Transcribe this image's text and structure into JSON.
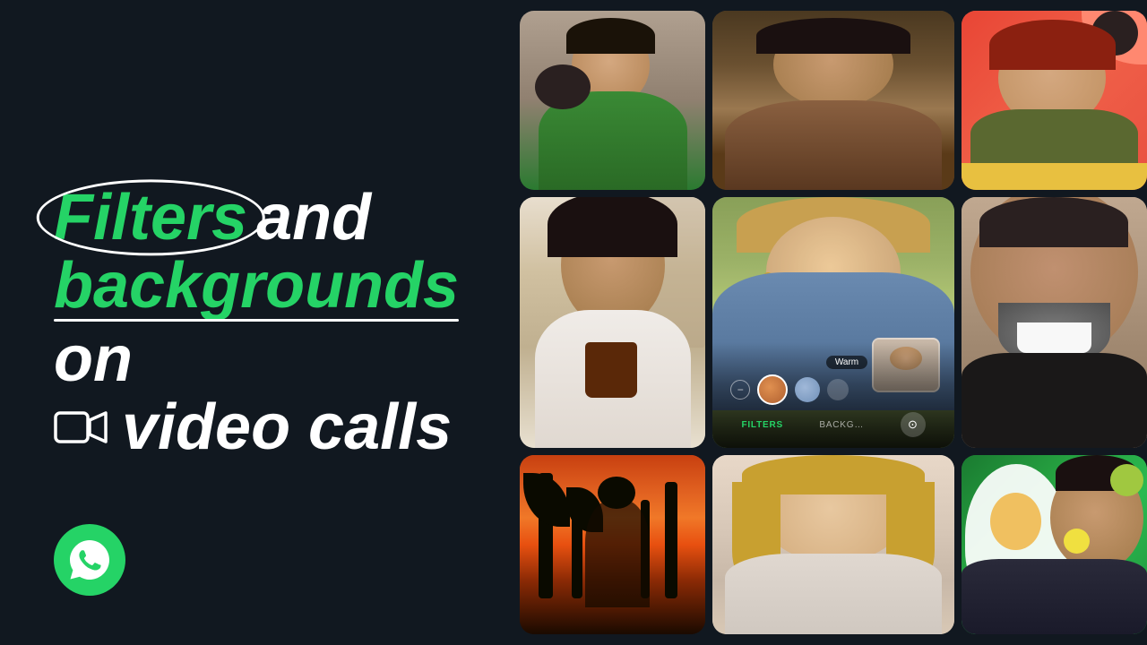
{
  "page": {
    "bg_color": "#111820",
    "title": "Filters and backgrounds on video calls"
  },
  "headline": {
    "line1_part1": "Filters",
    "line1_part2": "and",
    "line2_part1": "backgrounds",
    "line2_part2": "on",
    "line3_icon": "📹",
    "line3_text": "video calls"
  },
  "branding": {
    "logo_alt": "WhatsApp",
    "logo_color": "#25D366"
  },
  "phone_ui": {
    "filter_label": "Warm",
    "tab1": "FILTERS",
    "tab2": "BACKG…",
    "camera_icon": "📷"
  },
  "photos": {
    "col1": [
      "man with dog green shirt",
      "man with coffee cafe background",
      "woman sunset palm trees"
    ],
    "col2": [
      "woman smiling outdoor",
      "woman warm filter main",
      "blonde woman neutral"
    ],
    "col3": [
      "woman cartoon red background",
      "bearded man laughing",
      "asian man green sticker background"
    ]
  },
  "colors": {
    "green": "#25D366",
    "bg": "#111820",
    "white": "#ffffff"
  }
}
